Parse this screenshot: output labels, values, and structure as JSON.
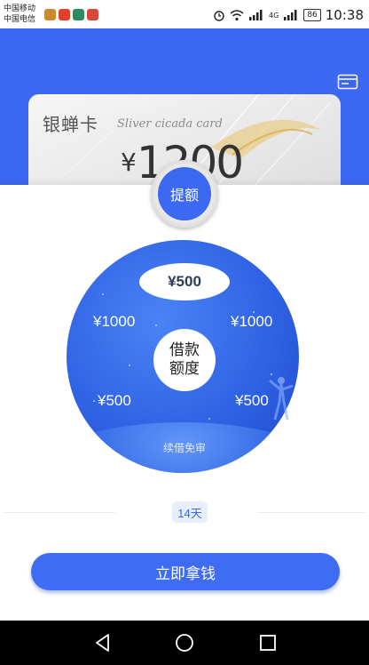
{
  "status_bar": {
    "carrier_1": "中国移动",
    "carrier_2": "中国电信",
    "network": "4G",
    "battery": "86",
    "time": "10:38"
  },
  "colors": {
    "accent": "#3c67f0",
    "button": "#3e6cf3",
    "chip_bg": "#e6eeff"
  },
  "header": {
    "card_icon": "card-icon"
  },
  "card": {
    "name": "银蝉卡",
    "subtitle": "Sliver cicada card",
    "currency": "¥",
    "amount": "1200"
  },
  "withdraw_button": "提额",
  "wheel": {
    "selected": "¥500",
    "options": {
      "left_upper": "¥1000",
      "right_upper": "¥1000",
      "left_lower": "¥500",
      "right_lower": "¥500"
    },
    "center_line_1": "借款",
    "center_line_2": "额度",
    "renew_text": "续借免审"
  },
  "period": "14天",
  "primary_action": "立即拿钱",
  "nav": {
    "back_icon": "back-triangle-icon",
    "home_icon": "home-circle-icon",
    "recents_icon": "recents-square-icon"
  }
}
